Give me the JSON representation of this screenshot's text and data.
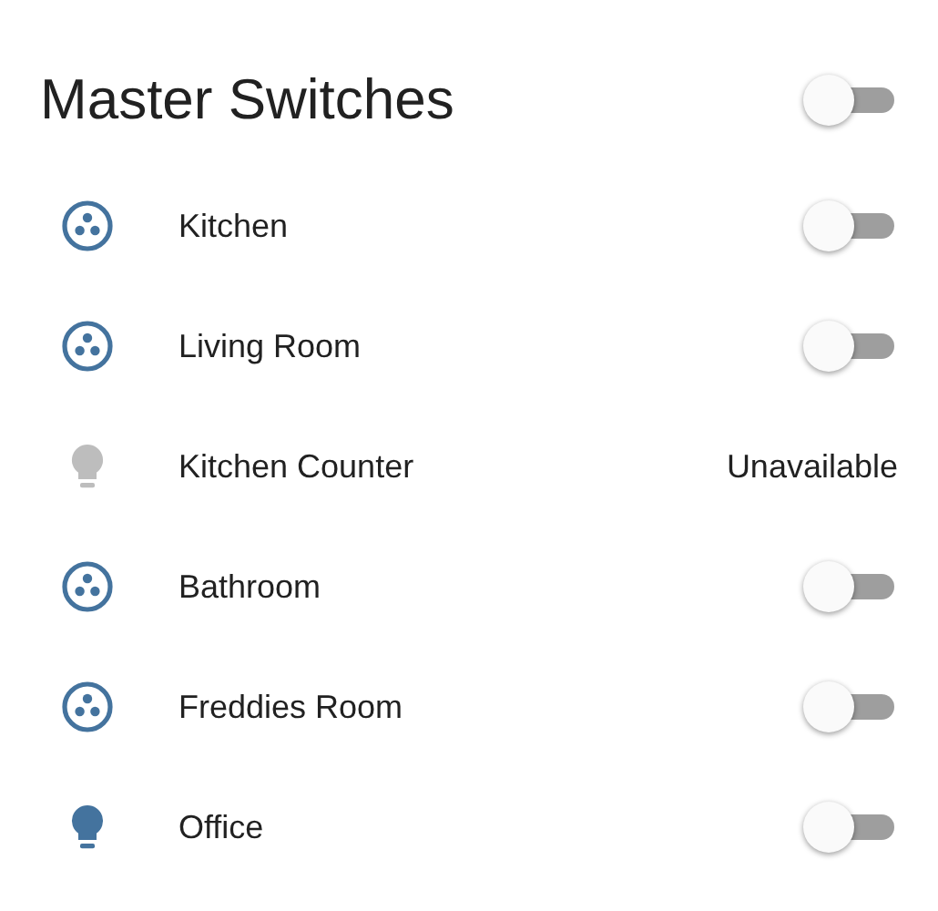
{
  "header": {
    "title": "Master Switches",
    "on": false
  },
  "rows": [
    {
      "kind": "group",
      "name": "Kitchen",
      "available": true,
      "on": false
    },
    {
      "kind": "group",
      "name": "Living Room",
      "available": true,
      "on": false
    },
    {
      "kind": "light",
      "name": "Kitchen Counter",
      "available": false,
      "state": "Unavailable"
    },
    {
      "kind": "group",
      "name": "Bathroom",
      "available": true,
      "on": false
    },
    {
      "kind": "group",
      "name": "Freddies Room",
      "available": true,
      "on": false
    },
    {
      "kind": "light",
      "name": "Office",
      "available": true,
      "on": false
    }
  ]
}
